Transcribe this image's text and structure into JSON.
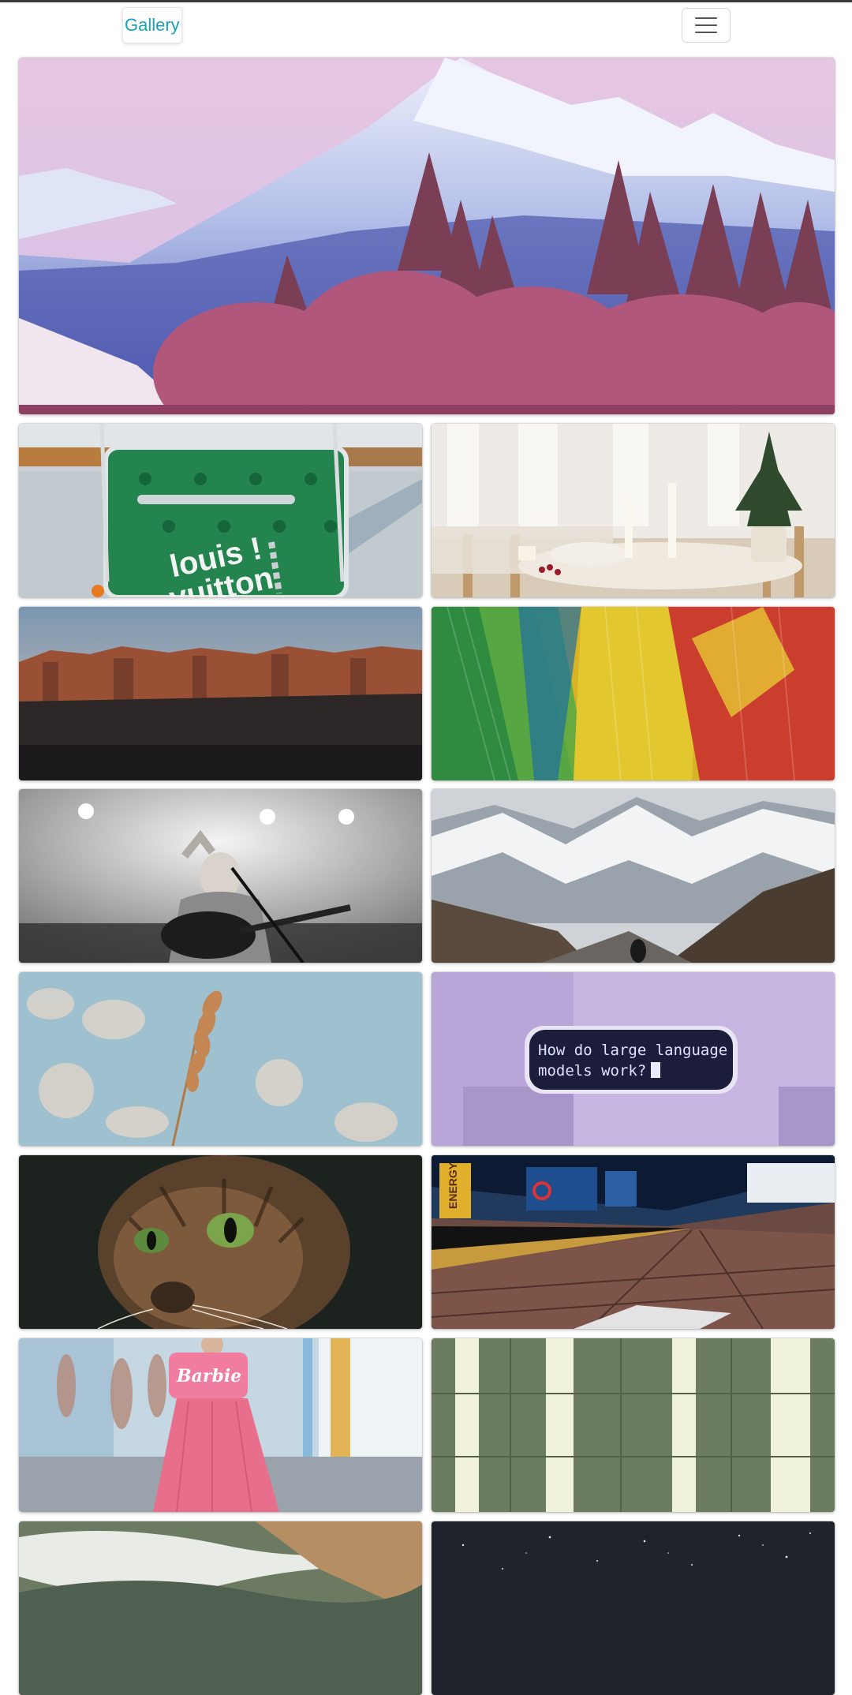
{
  "navbar": {
    "brand": "Gallery",
    "menu_icon": "hamburger-icon"
  },
  "gallery": {
    "hero_subject": "snowy mountains with pine trees",
    "photos": [
      {
        "subject": "green monogram bag",
        "printed_text": "louis vuitton"
      },
      {
        "subject": "dining table with candles and small pine tree"
      },
      {
        "subject": "red rock mesa at dusk"
      },
      {
        "subject": "colorful parrot feathers"
      },
      {
        "subject": "singer with guitar on stage, black and white"
      },
      {
        "subject": "snow-covered mountain valley"
      },
      {
        "subject": "dry grass stalk against blue sky"
      },
      {
        "subject": "glass screen on lilac background",
        "printed_text": "How do large language models work?"
      },
      {
        "subject": "tabby cat close-up"
      },
      {
        "subject": "underground station platform",
        "printed_text": "ENERGY"
      },
      {
        "subject": "person in pink outfit",
        "printed_text": "Barbie"
      },
      {
        "subject": "green and white panels"
      },
      {
        "subject": "waves on sandy beach"
      },
      {
        "subject": "starry night sky"
      }
    ]
  }
}
